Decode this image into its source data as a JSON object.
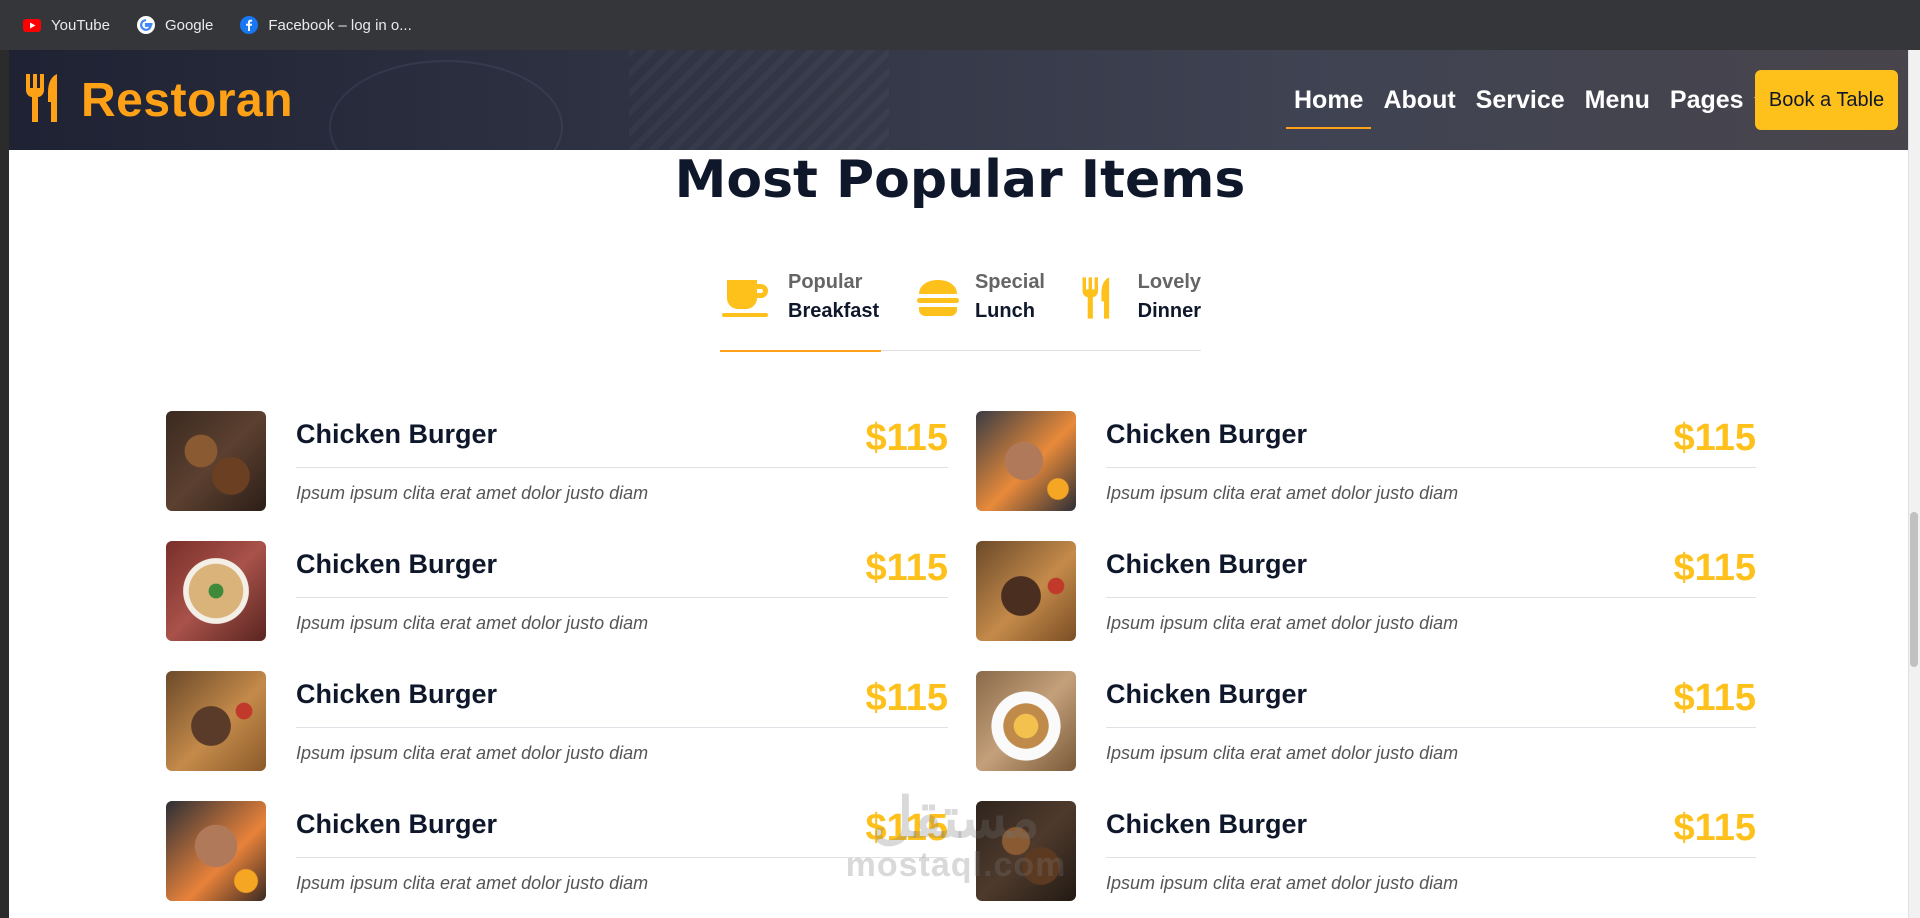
{
  "bookmarks": [
    {
      "label": "YouTube",
      "icon": "youtube-icon"
    },
    {
      "label": "Google",
      "icon": "google-icon"
    },
    {
      "label": "Facebook – log in o...",
      "icon": "facebook-icon"
    }
  ],
  "navbar": {
    "brand": "Restoran",
    "links": [
      "Home",
      "About",
      "Service",
      "Menu",
      "Pages"
    ],
    "active": "Home",
    "cta": "Book a Table"
  },
  "section": {
    "title": "Most Popular Items"
  },
  "tabs": [
    {
      "sub": "Popular",
      "main": "Breakfast",
      "icon": "coffee-cup-icon"
    },
    {
      "sub": "Special",
      "main": "Lunch",
      "icon": "hamburger-icon"
    },
    {
      "sub": "Lovely",
      "main": "Dinner",
      "icon": "utensils-icon"
    }
  ],
  "menu_items": [
    {
      "name": "Chicken Burger",
      "price": "$115",
      "desc": "Ipsum ipsum clita erat amet dolor justo diam"
    },
    {
      "name": "Chicken Burger",
      "price": "$115",
      "desc": "Ipsum ipsum clita erat amet dolor justo diam"
    },
    {
      "name": "Chicken Burger",
      "price": "$115",
      "desc": "Ipsum ipsum clita erat amet dolor justo diam"
    },
    {
      "name": "Chicken Burger",
      "price": "$115",
      "desc": "Ipsum ipsum clita erat amet dolor justo diam"
    },
    {
      "name": "Chicken Burger",
      "price": "$115",
      "desc": "Ipsum ipsum clita erat amet dolor justo diam"
    },
    {
      "name": "Chicken Burger",
      "price": "$115",
      "desc": "Ipsum ipsum clita erat amet dolor justo diam"
    },
    {
      "name": "Chicken Burger",
      "price": "$115",
      "desc": "Ipsum ipsum clita erat amet dolor justo diam"
    },
    {
      "name": "Chicken Burger",
      "price": "$115",
      "desc": "Ipsum ipsum clita erat amet dolor justo diam"
    }
  ],
  "watermark": {
    "arabic": "مستقل",
    "latin": "mostaql.com"
  },
  "colors": {
    "accent": "#fea116",
    "price": "#fec01a",
    "dark": "#0f172b"
  }
}
